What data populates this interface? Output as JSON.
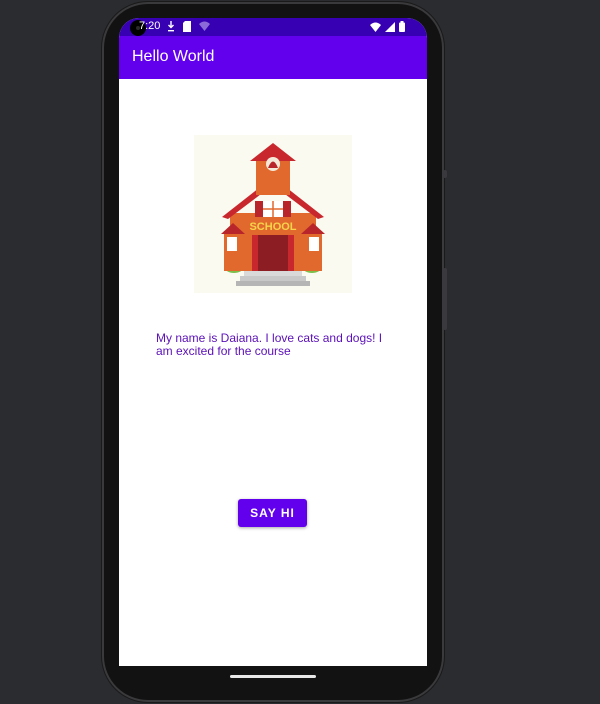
{
  "status_bar": {
    "time": "7:20",
    "left_icons": [
      "download-icon",
      "sd-card-icon",
      "wifi-calling-icon"
    ],
    "right_icons": [
      "wifi-icon",
      "signal-icon",
      "battery-icon"
    ]
  },
  "app_bar": {
    "title": "Hello World"
  },
  "main": {
    "image_name": "school-house-image",
    "intro_text": "My name is Daiana. I love cats and dogs! I am excited for the course",
    "button_label": "SAY HI"
  },
  "colors": {
    "primary": "#6200EE",
    "primary_dark": "#3700B3",
    "text_accent": "#5b10b8",
    "phone_frame": "#121212",
    "background": "#2b2c30"
  }
}
